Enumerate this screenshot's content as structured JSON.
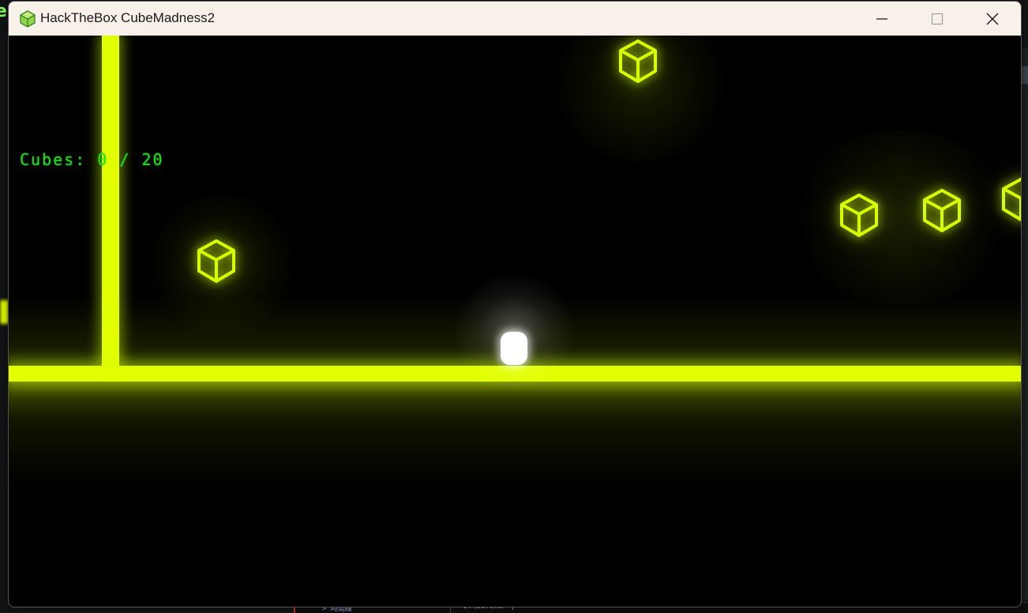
{
  "window": {
    "title": "HackTheBox CubeMadness2",
    "controls": {
      "minimize_icon": "minimize-icon",
      "maximize_icon": "maximize-icon",
      "close_icon": "close-icon"
    }
  },
  "hud": {
    "cubes_label": "Cubes: 0 / 20"
  },
  "game": {
    "accent_color": "#e2ff00",
    "hud_color": "#1fe01f",
    "player_color": "#ffffff",
    "cube_icon": "wireframe-cube-icon"
  },
  "backdrop": {
    "terminal_left": "> 時間線",
    "terminal_prompt": "D:\\auromar>|"
  }
}
